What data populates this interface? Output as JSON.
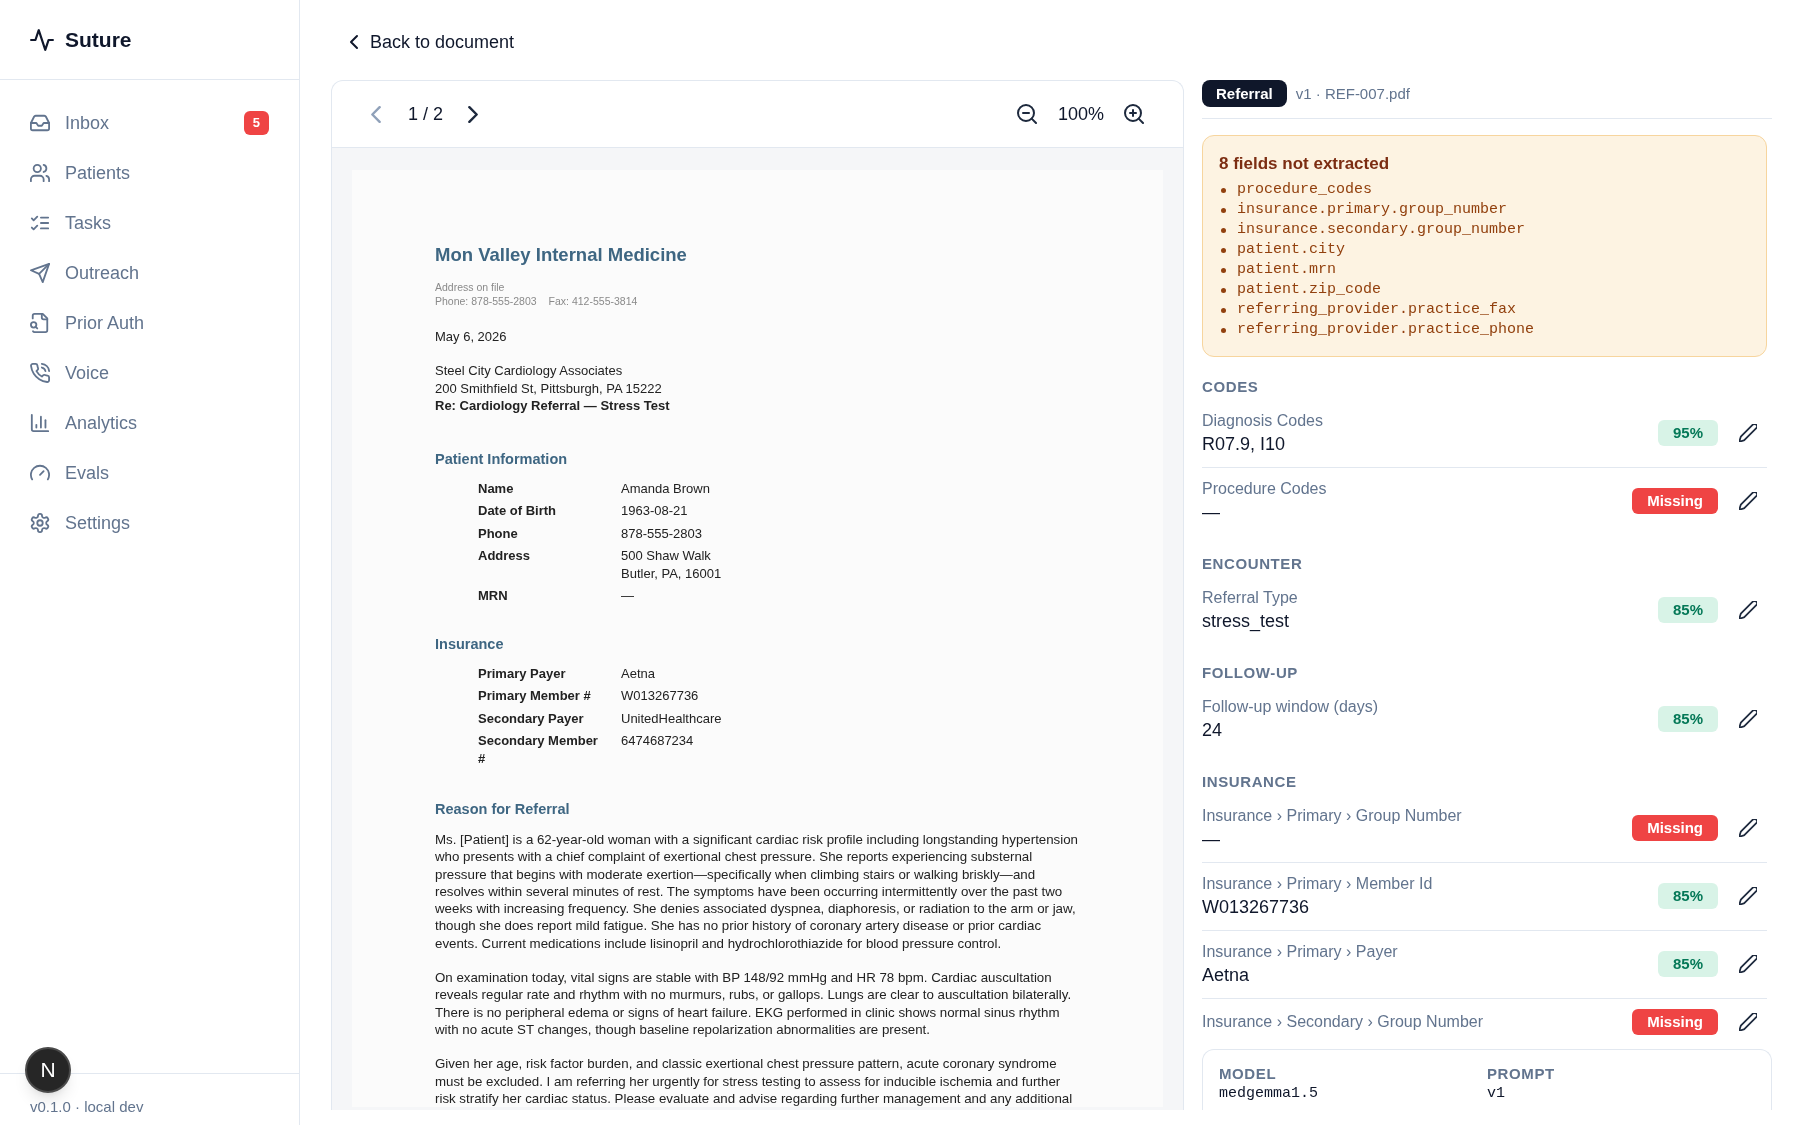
{
  "sidebar": {
    "brand": "Suture",
    "nav_items": [
      {
        "label": "Inbox",
        "badge": "5",
        "selected": false
      },
      {
        "label": "Patients",
        "selected": false
      },
      {
        "label": "Tasks",
        "selected": false
      },
      {
        "label": "Outreach",
        "selected": false
      },
      {
        "label": "Prior Auth",
        "selected": false
      },
      {
        "label": "Voice",
        "selected": false
      },
      {
        "label": "Analytics",
        "selected": false
      },
      {
        "label": "Evals",
        "selected": false
      },
      {
        "label": "Settings",
        "selected": false
      }
    ],
    "footer_text": "v0.1.0 · local dev"
  },
  "dev_indicator": "N",
  "back_link": "Back to document",
  "viewer": {
    "toolbar": {
      "prev_button": {
        "disabled": true
      },
      "page": "1 / 2",
      "next_button": {
        "disabled": false
      },
      "zoom": "100%"
    },
    "document": {
      "practice_name": "Mon Valley Internal Medicine",
      "practice_address": "Address on file",
      "practice_phone": "Phone: 878-555-2803",
      "practice_fax": "Fax: 412-555-3814",
      "date": "May 6, 2026",
      "recipient_lines": [
        "Steel City Cardiology Associates",
        "200 Smithfield St, Pittsburgh, PA 15222"
      ],
      "subject": "Re: Cardiology Referral — Stress Test",
      "sections": [
        {
          "heading": "Patient Information",
          "kind": "table",
          "rows": [
            {
              "label": "Name",
              "value": [
                "Amanda Brown"
              ]
            },
            {
              "label": "Date of Birth",
              "value": [
                "1963-08-21"
              ]
            },
            {
              "label": "Phone",
              "value": [
                "878-555-2803"
              ]
            },
            {
              "label": "Address",
              "value": [
                "500 Shaw Walk",
                "Butler, PA, 16001"
              ]
            },
            {
              "label": "MRN",
              "value": [
                "—"
              ]
            }
          ]
        },
        {
          "heading": "Insurance",
          "kind": "table",
          "rows": [
            {
              "label": "Primary Payer",
              "value": [
                "Aetna"
              ]
            },
            {
              "label": "Primary Member #",
              "value": [
                "W013267736"
              ]
            },
            {
              "label": "Secondary Payer",
              "value": [
                "UnitedHealthcare"
              ]
            },
            {
              "label": "Secondary Member #",
              "value": [
                "6474687234"
              ]
            }
          ]
        },
        {
          "heading": "Reason for Referral",
          "kind": "text",
          "paragraphs": [
            "Ms. [Patient] is a 62-year-old woman with a significant cardiac risk profile including longstanding hypertension who presents with a chief complaint of exertional chest pressure. She reports experiencing substernal pressure that begins with moderate exertion—specifically when climbing stairs or walking briskly—and resolves within several minutes of rest. The symptoms have been occurring intermittently over the past two weeks with increasing frequency. She denies associated dyspnea, diaphoresis, or radiation to the arm or jaw, though she does report mild fatigue. She has no prior history of coronary artery disease or prior cardiac events. Current medications include lisinopril and hydrochlorothiazide for blood pressure control.",
            "On examination today, vital signs are stable with BP 148/92 mmHg and HR 78 bpm. Cardiac auscultation reveals regular rate and rhythm with no murmurs, rubs, or gallops. Lungs are clear to auscultation bilaterally. There is no peripheral edema or signs of heart failure. EKG performed in clinic shows normal sinus rhythm with no acute ST changes, though baseline repolarization abnormalities are present.",
            "Given her age, risk factor burden, and classic exertional chest pressure pattern, acute coronary syndrome must be excluded. I am referring her urgently for stress testing to assess for inducible ischemia and further risk stratify her cardiac status. Please evaluate and advise regarding further management and any additional"
          ]
        }
      ]
    }
  },
  "extraction_panel": {
    "doc_type": "Referral",
    "file_info": "v1 · REF-007.pdf",
    "warning": {
      "title": "8 fields not extracted",
      "fields": [
        "procedure_codes",
        "insurance.primary.group_number",
        "insurance.secondary.group_number",
        "patient.city",
        "patient.mrn",
        "patient.zip_code",
        "referring_provider.practice_fax",
        "referring_provider.practice_phone"
      ]
    },
    "sections": [
      {
        "title": "CODES",
        "fields": [
          {
            "label": "Diagnosis Codes",
            "value": "R07.9, I10",
            "badge": {
              "kind": "confidence",
              "text": "95%"
            }
          },
          {
            "label": "Procedure Codes",
            "value": "—",
            "badge": {
              "kind": "missing",
              "text": "Missing"
            }
          }
        ]
      },
      {
        "title": "ENCOUNTER",
        "fields": [
          {
            "label": "Referral Type",
            "value": "stress_test",
            "badge": {
              "kind": "confidence",
              "text": "85%"
            }
          }
        ]
      },
      {
        "title": "FOLLOW-UP",
        "fields": [
          {
            "label": "Follow-up window (days)",
            "value": "24",
            "badge": {
              "kind": "confidence",
              "text": "85%"
            }
          }
        ]
      },
      {
        "title": "INSURANCE",
        "fields": [
          {
            "label": "Insurance › Primary › Group Number",
            "value": "—",
            "badge": {
              "kind": "missing",
              "text": "Missing"
            }
          },
          {
            "label": "Insurance › Primary › Member Id",
            "value": "W013267736",
            "badge": {
              "kind": "confidence",
              "text": "85%"
            }
          },
          {
            "label": "Insurance › Primary › Payer",
            "value": "Aetna",
            "badge": {
              "kind": "confidence",
              "text": "85%"
            }
          },
          {
            "label": "Insurance › Secondary › Group Number",
            "badge": {
              "kind": "missing",
              "text": "Missing"
            }
          }
        ]
      }
    ],
    "run_info": [
      {
        "label": "MODEL",
        "value": "medgemma1.5"
      },
      {
        "label": "PROMPT",
        "value": "v1"
      }
    ]
  }
}
